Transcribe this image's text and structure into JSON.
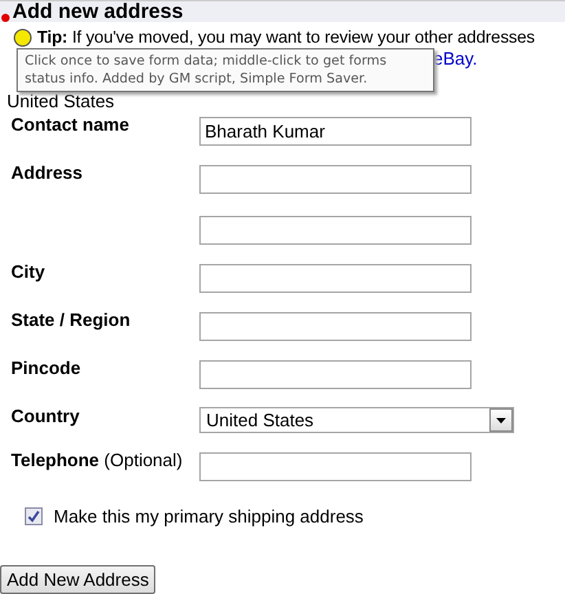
{
  "heading": "Add new address",
  "tip": {
    "label": "Tip:",
    "text": "If you've moved, you may want to review your other addresses",
    "link": "eBay."
  },
  "country_line": "United States",
  "tooltip": "Click once to save form data; middle-click to get forms status info.  Added by GM script, Simple Form Saver.",
  "fields": [
    {
      "label": "Contact name",
      "kind": "text",
      "value": "Bharath Kumar"
    },
    {
      "label": "Address",
      "kind": "two_lines"
    },
    {
      "label": "City",
      "kind": "text"
    },
    {
      "label": "State / Region",
      "kind": "text"
    },
    {
      "label": "Pincode",
      "kind": "text"
    },
    {
      "label": "Country",
      "kind": "select",
      "value": "United States"
    },
    {
      "label": "Telephone",
      "note": "(Optional)",
      "kind": "text"
    }
  ],
  "primary": {
    "label": "Make this my primary shipping address",
    "checked": true
  },
  "submit": "Add New Address"
}
